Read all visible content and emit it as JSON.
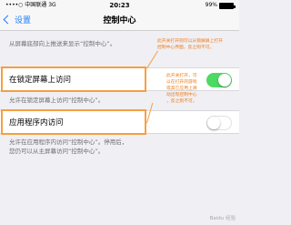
{
  "status_bar": {
    "carrier": "••••○ 中国联通 3G",
    "time": "20:23",
    "battery": "99%"
  },
  "nav": {
    "back_label": "设置",
    "title": "控制中心"
  },
  "section": {
    "description": "从屏幕底部向上推送来显示“控制中心”。"
  },
  "settings": [
    {
      "label": "在锁定屏幕上访问",
      "enabled": true,
      "description": "允许在锁定屏幕上访问“控制中心”。"
    },
    {
      "label": "应用程序内访问",
      "enabled": false,
      "description": "允许在应用程序内访问“控制中心”。停用后，\n您仍可以从主屏幕访问“控制中心”。"
    }
  ],
  "annotations": [
    "此开关打开则可以从锁屏屏上打开\n控制中心界面，反之则不可。",
    "此开关打开，可\n以在打开的游戏\n或其它应用上滑\n动出现控制中心\n，反之则不可。"
  ],
  "colors": {
    "accent": "#1f7ff6",
    "switch_on": "#4cd964",
    "highlight": "#f5a040",
    "annotation_text": "#f07a14"
  },
  "watermark": "Baidu 经验"
}
